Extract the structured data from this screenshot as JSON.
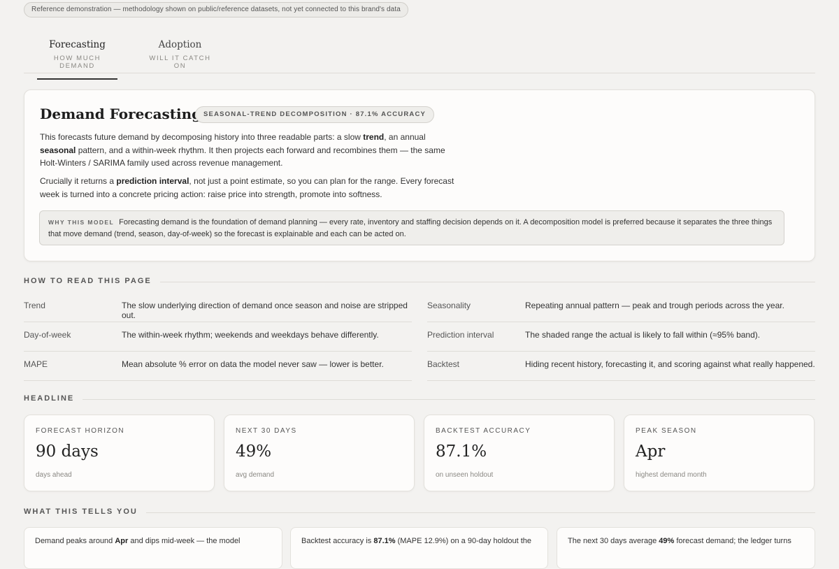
{
  "notice": "Reference demonstration — methodology shown on public/reference datasets, not yet connected to this brand's data",
  "tabs": [
    {
      "title": "Forecasting",
      "sub": "HOW MUCH DEMAND"
    },
    {
      "title": "Adoption",
      "sub": "WILL IT CATCH ON"
    }
  ],
  "main": {
    "title": "Demand Forecasting",
    "badge": "SEASONAL-TREND DECOMPOSITION · 87.1% ACCURACY",
    "p1": {
      "a": "This forecasts future demand by decomposing history into three readable parts: a slow ",
      "b1": "trend",
      "c": ", an annual ",
      "b2": "seasonal",
      "d": " pattern, and a within-week rhythm. It then projects each forward and recombines them — the same Holt-Winters / SARIMA family used across revenue management."
    },
    "p2": {
      "a": "Crucially it returns a ",
      "b1": "prediction interval",
      "c": ", not just a point estimate, so you can plan for the range. Every forecast week is turned into a concrete pricing action: raise price into strength, promote into softness."
    },
    "why_label": "WHY THIS MODEL",
    "why_text": "Forecasting demand is the foundation of demand planning — every rate, inventory and staffing decision depends on it. A decomposition model is preferred because it separates the three things that move demand (trend, season, day-of-week) so the forecast is explainable and each can be acted on."
  },
  "sections": {
    "how_to_read": "HOW TO READ THIS PAGE",
    "headline": "HEADLINE",
    "tells": "WHAT THIS TELLS YOU"
  },
  "glossary": [
    {
      "term": "Trend",
      "def": "The slow underlying direction of demand once season and noise are stripped out."
    },
    {
      "term": "Seasonality",
      "def": "Repeating annual pattern — peak and trough periods across the year."
    },
    {
      "term": "Day-of-week",
      "def": "The within-week rhythm; weekends and weekdays behave differently."
    },
    {
      "term": "Prediction interval",
      "def": "The shaded range the actual is likely to fall within (≈95% band)."
    },
    {
      "term": "MAPE",
      "def": "Mean absolute % error on data the model never saw — lower is better."
    },
    {
      "term": "Backtest",
      "def": "Hiding recent history, forecasting it, and scoring against what really happened."
    }
  ],
  "kpis": [
    {
      "label": "FORECAST HORIZON",
      "value": "90 days",
      "sub": "days ahead"
    },
    {
      "label": "NEXT 30 DAYS",
      "value": "49%",
      "sub": "avg demand"
    },
    {
      "label": "BACKTEST ACCURACY",
      "value": "87.1%",
      "sub": "on unseen holdout"
    },
    {
      "label": "PEAK SEASON",
      "value": "Apr",
      "sub": "highest demand month"
    }
  ],
  "insights": [
    {
      "a": "Demand peaks around ",
      "b": "Apr",
      "c": " and dips mid-week — the model"
    },
    {
      "a": "Backtest accuracy is ",
      "b": "87.1%",
      "c": " (MAPE 12.9%) on a 90-day holdout the"
    },
    {
      "a": "The next 30 days average ",
      "b": "49%",
      "c": " forecast demand; the ledger turns"
    }
  ]
}
